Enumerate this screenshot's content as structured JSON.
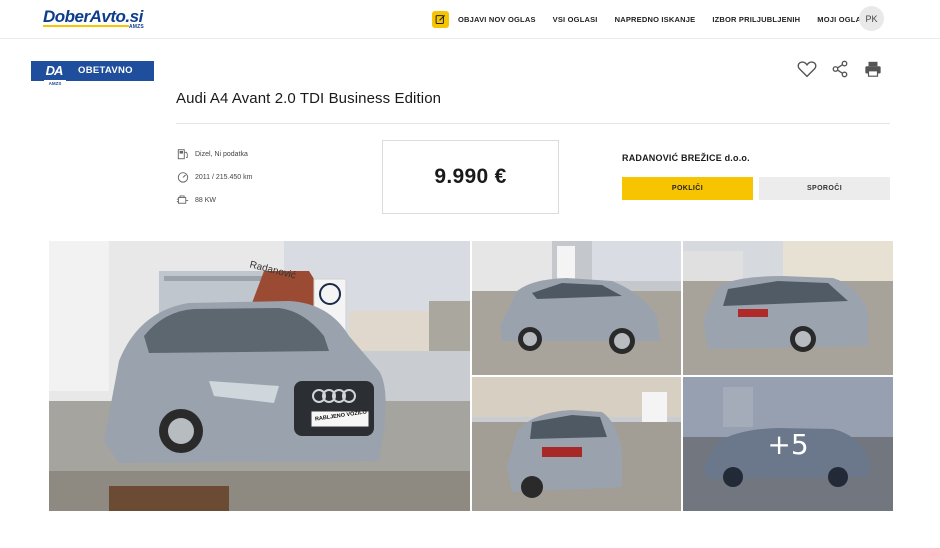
{
  "header": {
    "logo_text": "DoberAvto.si",
    "logo_sub": "AMZS",
    "nav": [
      {
        "label": "OBJAVI NOV OGLAS"
      },
      {
        "label": "VSI OGLASI"
      },
      {
        "label": "NAPREDNO ISKANJE"
      },
      {
        "label": "IZBOR PRILJUBLJENIH"
      },
      {
        "label": "MOJI OGLASI"
      }
    ],
    "avatar_initials": "PK"
  },
  "badge": {
    "logo": "DA",
    "logo_sub": "AMZS",
    "label": "OBETAVNO"
  },
  "actions": {
    "favorite_icon": "heart-icon",
    "share_icon": "share-icon",
    "print_icon": "printer-icon"
  },
  "listing": {
    "title": "Audi A4 Avant 2.0 TDI Business Edition",
    "specs": [
      {
        "icon": "fuel-pump-icon",
        "text": "Dizel, Ni podatka"
      },
      {
        "icon": "speedometer-icon",
        "text": "2011 / 215.450 km"
      },
      {
        "icon": "engine-icon",
        "text": "88 KW"
      }
    ],
    "price": "9.990 €"
  },
  "seller": {
    "name": "RADANOVIĆ BREŽICE d.o.o.",
    "call_label": "POKLIČI",
    "message_label": "SPOROČI"
  },
  "gallery": {
    "main_plate": "RABLJENO VOZILO",
    "dealer_sign": "Radanović",
    "more_label": "+5"
  },
  "colors": {
    "accent_yellow": "#f6c400",
    "brand_blue": "#1f4e9c",
    "car_silver": "#9aa3ad"
  }
}
